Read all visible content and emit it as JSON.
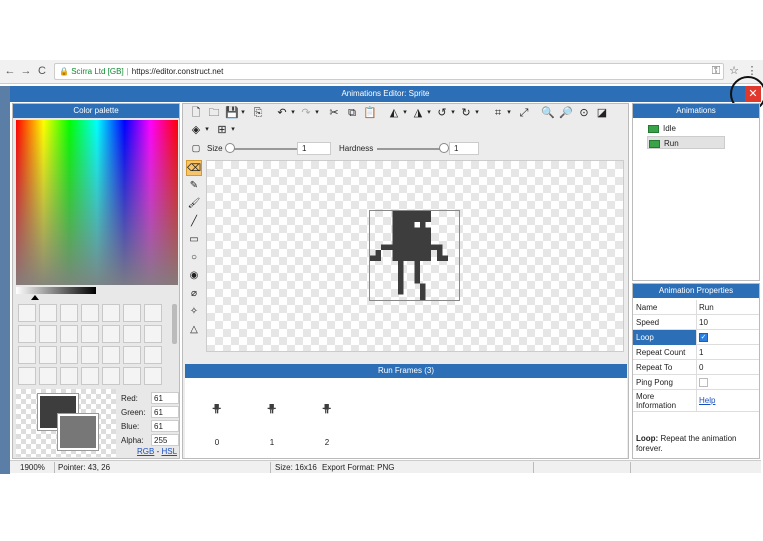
{
  "browser": {
    "back": "←",
    "forward": "→",
    "reload": "C",
    "site_name": "Scirra Ltd [GB]",
    "url": "https://editor.construct.net",
    "key_icon": "⚿",
    "star_icon": "☆",
    "menu_icon": "⋮"
  },
  "editor": {
    "title": "Animations Editor: Sprite",
    "close": "✕"
  },
  "palette": {
    "header": "Color palette",
    "red_label": "Red:",
    "red": "61",
    "green_label": "Green:",
    "green": "61",
    "blue_label": "Blue:",
    "blue": "61",
    "alpha_label": "Alpha:",
    "alpha": "255",
    "rgb_link": "RGB",
    "dash": " - ",
    "hsl_link": "HSL",
    "primary_color": "#3d3d3d",
    "secondary_color": "#777777"
  },
  "brush": {
    "size_label": "Size",
    "size_value": "1",
    "hardness_label": "Hardness",
    "hardness_value": "1"
  },
  "frames": {
    "header": "Run Frames (3)",
    "items": [
      "0",
      "1",
      "2"
    ]
  },
  "animations": {
    "header": "Animations",
    "items": [
      "Idle",
      "Run"
    ],
    "selected": "Run"
  },
  "properties": {
    "header": "Animation Properties",
    "rows": [
      {
        "name": "Name",
        "value": "Run"
      },
      {
        "name": "Speed",
        "value": "10"
      },
      {
        "name": "Loop",
        "value": ""
      },
      {
        "name": "Repeat Count",
        "value": "1"
      },
      {
        "name": "Repeat To",
        "value": "0"
      },
      {
        "name": "Ping Pong",
        "value": ""
      },
      {
        "name": "More Information",
        "value": "Help"
      }
    ],
    "desc_title": "Loop:",
    "desc_text": " Repeat the animation forever."
  },
  "status": {
    "zoom": "1900%",
    "pointer": "Pointer: 43, 26",
    "size": "Size: 16x16",
    "export": "Export Format: PNG"
  },
  "colors": {
    "accent": "#2c6fb7",
    "close_red": "#e0382c",
    "sprite": "#3d3d3d"
  }
}
